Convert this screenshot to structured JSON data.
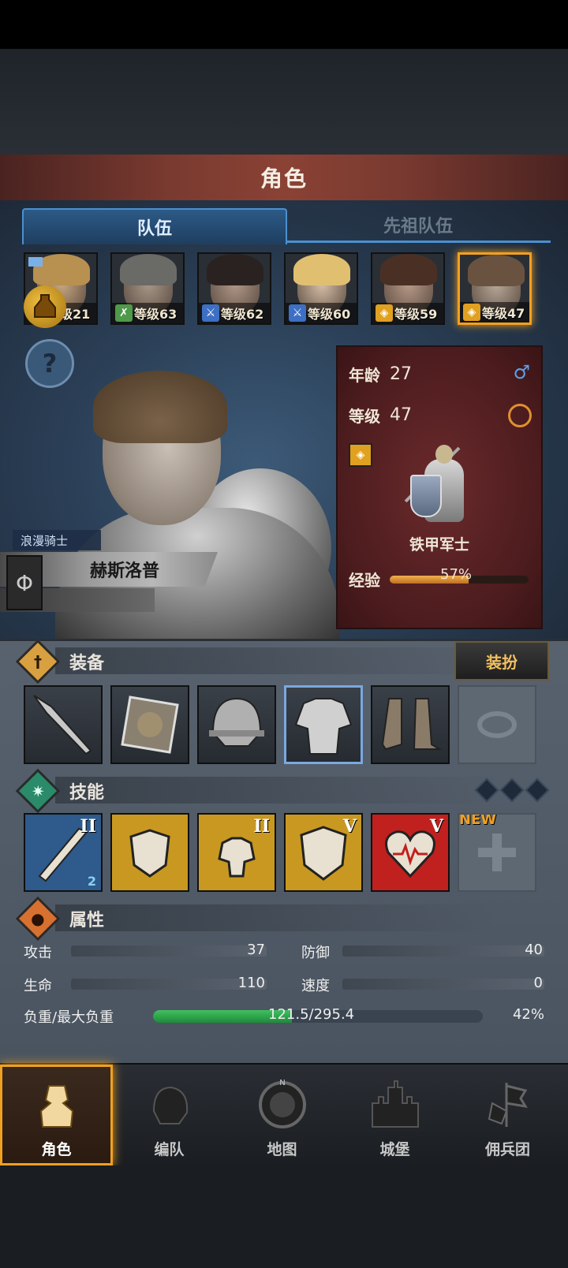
{
  "header": {
    "title": "角色"
  },
  "tabs": {
    "team": "队伍",
    "ancestor": "先祖队伍"
  },
  "roster": [
    {
      "class_icon": "sword-icon",
      "level": "等级21",
      "skin": "#c9a880",
      "hair": "#b89050",
      "cls": "cls-sword",
      "glyph": "⚔"
    },
    {
      "class_icon": "bow-icon",
      "level": "等级63",
      "skin": "#a89888",
      "hair": "#6a6a66",
      "cls": "cls-bow",
      "glyph": "✗"
    },
    {
      "class_icon": "sword-icon",
      "level": "等级62",
      "skin": "#b09888",
      "hair": "#2a2220",
      "cls": "cls-sword",
      "glyph": "⚔"
    },
    {
      "class_icon": "sword-icon",
      "level": "等级60",
      "skin": "#d8c0a8",
      "hair": "#e0c070",
      "cls": "cls-sword",
      "glyph": "⚔"
    },
    {
      "class_icon": "shield-icon",
      "level": "等级59",
      "skin": "#b89a88",
      "hair": "#4a3024",
      "cls": "cls-shield",
      "glyph": "◈"
    },
    {
      "class_icon": "shield-icon",
      "level": "等级47",
      "skin": "#b8a898",
      "hair": "#6a5240",
      "cls": "cls-shield",
      "glyph": "◈"
    }
  ],
  "hero": {
    "subclass": "浪漫骑士",
    "name": "赫斯洛普",
    "age_label": "年龄",
    "age": "27",
    "level_label": "等级",
    "level": "47",
    "class_name": "铁甲军士",
    "exp_label": "经验",
    "exp_percent": 57,
    "exp_text": "57%",
    "gender_symbol": "♂"
  },
  "equipment": {
    "title": "装备",
    "dress_button": "装扮",
    "slots": [
      "spear",
      "shield",
      "helmet",
      "chest-armor",
      "boots",
      "ring-empty"
    ]
  },
  "skills": {
    "title": "技能",
    "items": [
      {
        "rank": "II",
        "badge": "2"
      },
      {
        "rank": ""
      },
      {
        "rank": "II"
      },
      {
        "rank": "V"
      },
      {
        "rank": "V"
      },
      {
        "new": "NEW"
      }
    ]
  },
  "attributes": {
    "title": "属性",
    "attack_label": "攻击",
    "attack": "37",
    "defense_label": "防御",
    "defense": "40",
    "hp_label": "生命",
    "hp": "110",
    "speed_label": "速度",
    "speed": "0",
    "load_label": "负重/最大负重",
    "load_text": "121.5/295.4",
    "load_percent_text": "42%",
    "load_fraction": 0.42
  },
  "nav": {
    "character": "角色",
    "formation": "编队",
    "map": "地图",
    "castle": "城堡",
    "mercenary": "佣兵团",
    "compass_n": "N"
  },
  "colors": {
    "accent": "#f0a020",
    "tab_blue": "#4a90d0",
    "header_red": "#7a3a30"
  }
}
